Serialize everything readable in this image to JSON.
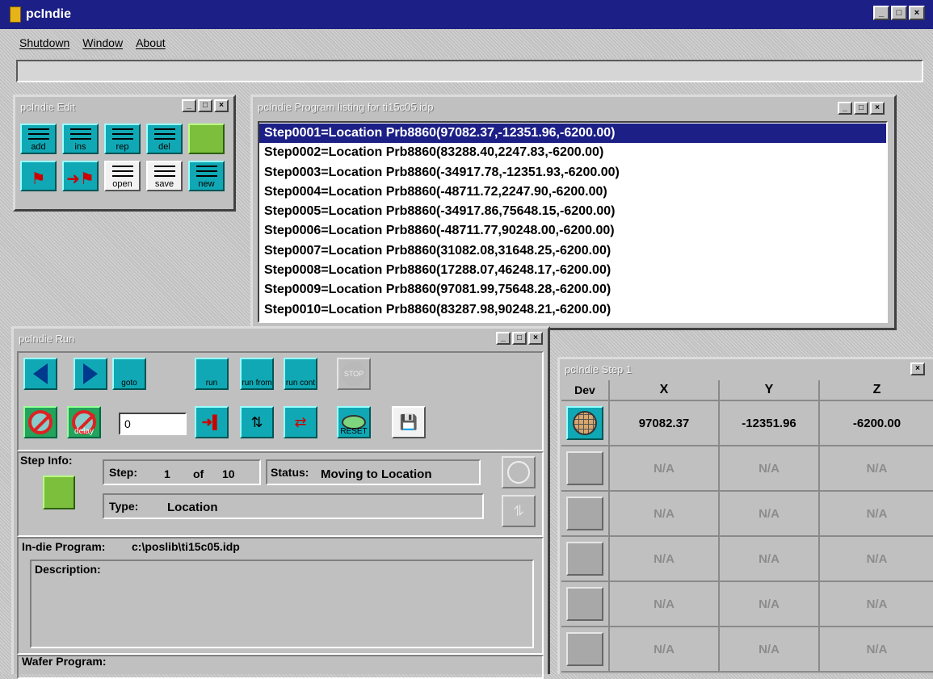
{
  "app": {
    "title": "pcIndie",
    "minimize": "_",
    "maximize": "□",
    "close": "×"
  },
  "menu": [
    "Shutdown",
    "Window",
    "About"
  ],
  "edit": {
    "title": "pcIndie Edit",
    "buttons": [
      "add",
      "ins",
      "rep",
      "del",
      "",
      "",
      "",
      "open",
      "save",
      "new"
    ]
  },
  "listing": {
    "title": "pcIndie Program listing for ti15c05.idp",
    "rows": [
      "Step0001=Location Prb8860(97082.37,-12351.96,-6200.00)",
      "Step0002=Location Prb8860(83288.40,2247.83,-6200.00)",
      "Step0003=Location Prb8860(-34917.78,-12351.93,-6200.00)",
      "Step0004=Location Prb8860(-48711.72,2247.90,-6200.00)",
      "Step0005=Location Prb8860(-34917.86,75648.15,-6200.00)",
      "Step0006=Location Prb8860(-48711.77,90248.00,-6200.00)",
      "Step0007=Location Prb8860(31082.08,31648.25,-6200.00)",
      "Step0008=Location Prb8860(17288.07,46248.17,-6200.00)",
      "Step0009=Location Prb8860(97081.99,75648.28,-6200.00)",
      "Step0010=Location Prb8860(83287.98,90248.21,-6200.00)"
    ]
  },
  "run": {
    "title": "pcIndie Run",
    "goto": "goto",
    "run": "run",
    "run_from": "run from",
    "run_cont": "run cont",
    "stop": "STOP",
    "delay": "delay",
    "reset": "RESET",
    "counter_value": "0",
    "step_info_label": "Step Info:",
    "step_label": "Step:",
    "step_num": "1",
    "of_label": "of",
    "step_total": "10",
    "status_label": "Status:",
    "status_value": "Moving to Location",
    "type_label": "Type:",
    "type_value": "Location",
    "indie_program_label": "In-die Program:",
    "indie_program_path": "c:\\poslib\\ti15c05.idp",
    "description_label": "Description:",
    "wafer_program_label": "Wafer Program:"
  },
  "step": {
    "title": "pcIndie Step 1",
    "headers": [
      "Dev",
      "X",
      "Y",
      "Z"
    ],
    "rows": [
      {
        "x": "97082.37",
        "y": "-12351.96",
        "z": "-6200.00"
      },
      {
        "x": "N/A",
        "y": "N/A",
        "z": "N/A"
      },
      {
        "x": "N/A",
        "y": "N/A",
        "z": "N/A"
      },
      {
        "x": "N/A",
        "y": "N/A",
        "z": "N/A"
      },
      {
        "x": "N/A",
        "y": "N/A",
        "z": "N/A"
      },
      {
        "x": "N/A",
        "y": "N/A",
        "z": "N/A"
      }
    ]
  }
}
